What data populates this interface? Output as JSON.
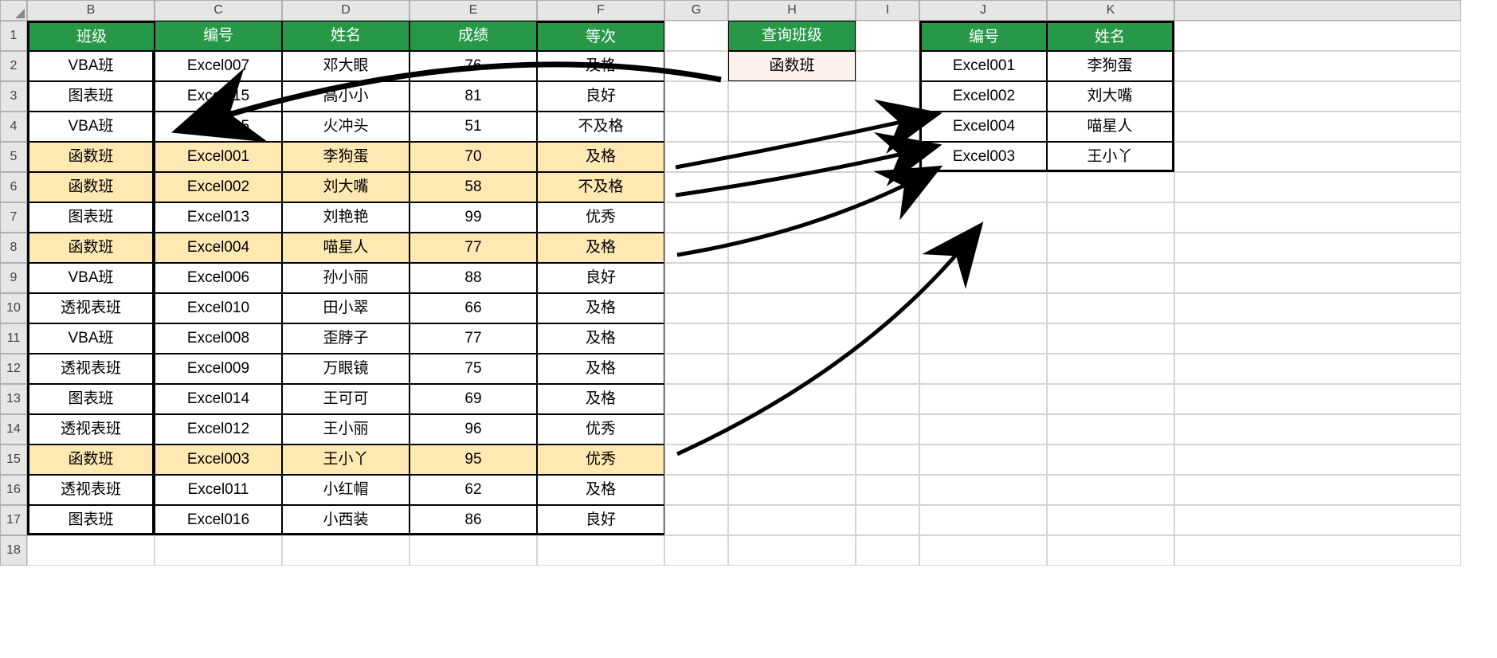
{
  "columns": [
    "",
    "B",
    "C",
    "D",
    "E",
    "F",
    "G",
    "H",
    "I",
    "J",
    "K",
    ""
  ],
  "rows": [
    "1",
    "2",
    "3",
    "4",
    "5",
    "6",
    "7",
    "8",
    "9",
    "10",
    "11",
    "12",
    "13",
    "14",
    "15",
    "16",
    "17",
    "18"
  ],
  "mainHeaders": {
    "B": "班级",
    "C": "编号",
    "D": "姓名",
    "E": "成绩",
    "F": "等次"
  },
  "queryHeader": "查询班级",
  "queryValue": "函数班",
  "resultHeaders": {
    "J": "编号",
    "K": "姓名"
  },
  "mainData": [
    {
      "row": 2,
      "class": "VBA班",
      "id": "Excel007",
      "name": "邓大眼",
      "score": "76",
      "grade": "及格",
      "hl": false
    },
    {
      "row": 3,
      "class": "图表班",
      "id": "Excel015",
      "name": "高小小",
      "score": "81",
      "grade": "良好",
      "hl": false
    },
    {
      "row": 4,
      "class": "VBA班",
      "id": "Excel005",
      "name": "火冲头",
      "score": "51",
      "grade": "不及格",
      "hl": false
    },
    {
      "row": 5,
      "class": "函数班",
      "id": "Excel001",
      "name": "李狗蛋",
      "score": "70",
      "grade": "及格",
      "hl": true
    },
    {
      "row": 6,
      "class": "函数班",
      "id": "Excel002",
      "name": "刘大嘴",
      "score": "58",
      "grade": "不及格",
      "hl": true
    },
    {
      "row": 7,
      "class": "图表班",
      "id": "Excel013",
      "name": "刘艳艳",
      "score": "99",
      "grade": "优秀",
      "hl": false
    },
    {
      "row": 8,
      "class": "函数班",
      "id": "Excel004",
      "name": "喵星人",
      "score": "77",
      "grade": "及格",
      "hl": true
    },
    {
      "row": 9,
      "class": "VBA班",
      "id": "Excel006",
      "name": "孙小丽",
      "score": "88",
      "grade": "良好",
      "hl": false
    },
    {
      "row": 10,
      "class": "透视表班",
      "id": "Excel010",
      "name": "田小翠",
      "score": "66",
      "grade": "及格",
      "hl": false
    },
    {
      "row": 11,
      "class": "VBA班",
      "id": "Excel008",
      "name": "歪脖子",
      "score": "77",
      "grade": "及格",
      "hl": false
    },
    {
      "row": 12,
      "class": "透视表班",
      "id": "Excel009",
      "name": "万眼镜",
      "score": "75",
      "grade": "及格",
      "hl": false
    },
    {
      "row": 13,
      "class": "图表班",
      "id": "Excel014",
      "name": "王可可",
      "score": "69",
      "grade": "及格",
      "hl": false
    },
    {
      "row": 14,
      "class": "透视表班",
      "id": "Excel012",
      "name": "王小丽",
      "score": "96",
      "grade": "优秀",
      "hl": false
    },
    {
      "row": 15,
      "class": "函数班",
      "id": "Excel003",
      "name": "王小丫",
      "score": "95",
      "grade": "优秀",
      "hl": true
    },
    {
      "row": 16,
      "class": "透视表班",
      "id": "Excel011",
      "name": "小红帽",
      "score": "62",
      "grade": "及格",
      "hl": false
    },
    {
      "row": 17,
      "class": "图表班",
      "id": "Excel016",
      "name": "小西装",
      "score": "86",
      "grade": "良好",
      "hl": false
    }
  ],
  "resultData": [
    {
      "row": 2,
      "id": "Excel001",
      "name": "李狗蛋"
    },
    {
      "row": 3,
      "id": "Excel002",
      "name": "刘大嘴"
    },
    {
      "row": 4,
      "id": "Excel004",
      "name": "喵星人"
    },
    {
      "row": 5,
      "id": "Excel003",
      "name": "王小丫"
    }
  ],
  "resultEmptyRows": [
    6,
    7,
    8,
    9,
    10
  ],
  "colors": {
    "headerBg": "#279848",
    "highlightBg": "#ffe9b3",
    "queryBg": "#fdf1ec"
  }
}
